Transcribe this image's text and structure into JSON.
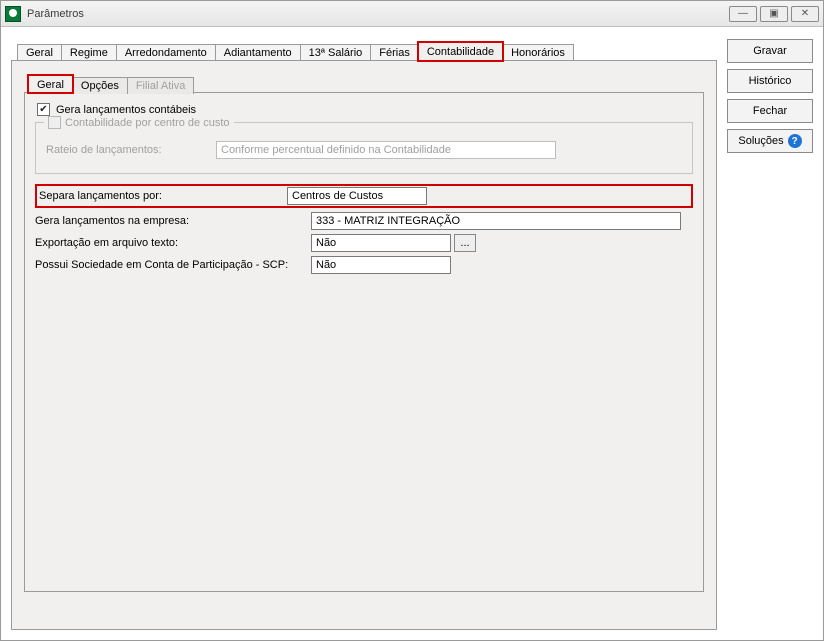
{
  "window": {
    "title": "Parâmetros"
  },
  "outer_tabs": {
    "items": [
      {
        "label": "Geral"
      },
      {
        "label": "Regime"
      },
      {
        "label": "Arredondamento"
      },
      {
        "label": "Adiantamento"
      },
      {
        "label": "13ª Salário"
      },
      {
        "label": "Férias"
      },
      {
        "label": "Contabilidade"
      },
      {
        "label": "Honorários"
      }
    ]
  },
  "inner_tabs": {
    "items": [
      {
        "label": "Geral"
      },
      {
        "label": "Opções"
      },
      {
        "label": "Filial Ativa"
      }
    ]
  },
  "form": {
    "gera_lanc_label": "Gera lançamentos contábeis",
    "group_legend": "Contabilidade por centro de custo",
    "rateio_label": "Rateio de lançamentos:",
    "rateio_value": "Conforme percentual definido na Contabilidade",
    "separa_label": "Separa lançamentos por:",
    "separa_value": "Centros de Custos",
    "empresa_label": "Gera lançamentos na empresa:",
    "empresa_value": "333 - MATRIZ INTEGRAÇÃO",
    "exportacao_label": "Exportação em arquivo texto:",
    "exportacao_value": "Não",
    "scp_label": "Possui Sociedade em Conta de Participação - SCP:",
    "scp_value": "Não",
    "ellipsis": "..."
  },
  "buttons": {
    "gravar": "Gravar",
    "historico": "Histórico",
    "fechar": "Fechar",
    "solucoes": "Soluções",
    "help_glyph": "?"
  },
  "winctl": {
    "min": "—",
    "max": "▣",
    "close": "✕"
  }
}
